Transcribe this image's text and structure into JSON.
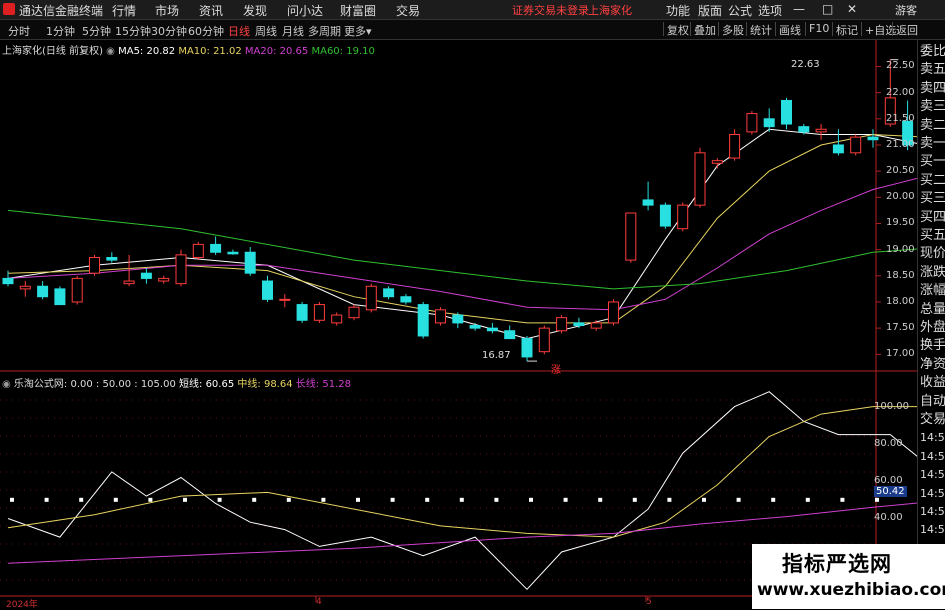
{
  "app": {
    "title": "通达信金融终端",
    "login_notice": "证券交易未登录",
    "stock_name": "上海家化",
    "guest": "游客"
  },
  "menu": {
    "items": [
      "行情",
      "市场",
      "资讯",
      "发现",
      "问小达",
      "财富圈",
      "交易"
    ],
    "right_items": [
      "功能",
      "版面",
      "公式",
      "选项"
    ]
  },
  "period_tabs": [
    "分时",
    "1分钟",
    "5分钟",
    "15分钟",
    "30分钟",
    "60分钟",
    "日线",
    "周线",
    "月线",
    "多周期",
    "更多"
  ],
  "active_tab": "日线",
  "toolbar": [
    "复权",
    "叠加",
    "多股",
    "统计",
    "画线",
    "F10",
    "标记",
    "+自选",
    "返回"
  ],
  "main_legend": {
    "title": "上海家化(日线 前复权)",
    "ma": [
      {
        "label": "MA5:",
        "value": "20.82",
        "color": "#ffffff"
      },
      {
        "label": "MA10:",
        "value": "21.02",
        "color": "#e8d460"
      },
      {
        "label": "MA20:",
        "value": "20.65",
        "color": "#d040d0"
      },
      {
        "label": "MA60:",
        "value": "19.10",
        "color": "#30c030"
      }
    ]
  },
  "indicator_legend": {
    "name": "乐淘公式网",
    "params": ": 0.00 : 50.00 : 105.00",
    "lines": [
      {
        "label": "短线:",
        "value": "60.65",
        "color": "#ffffff"
      },
      {
        "label": "中线:",
        "value": "98.64",
        "color": "#e8d460"
      },
      {
        "label": "长线:",
        "value": "51.28",
        "color": "#d040d0"
      }
    ]
  },
  "price_axis": [
    "22.50",
    "22.00",
    "21.50",
    "21.00",
    "20.50",
    "20.00",
    "19.50",
    "19.00",
    "18.50",
    "18.00",
    "17.50",
    "17.00"
  ],
  "indicator_axis": [
    "100.00",
    "80.00",
    "60.00",
    "40.00"
  ],
  "indicator_marker": "50.42",
  "annotations": {
    "high": "22.63",
    "low": "16.87",
    "signal": "涨"
  },
  "date_labels": [
    "2024年",
    "4",
    "5"
  ],
  "sidebar": [
    "委比",
    "卖五",
    "卖四",
    "卖三",
    "卖二",
    "卖一",
    "买一",
    "买二",
    "买三",
    "买四",
    "买五",
    "现价",
    "涨跌",
    "涨幅",
    "总量",
    "外盘",
    "换手",
    "净资",
    "收益",
    "自动",
    "交易",
    "14:56",
    "14:56",
    "14:56",
    "14:56",
    "14:56",
    "14:56",
    "14:56",
    "14:56",
    "14:56"
  ],
  "watermark": {
    "line1": "指标严选网",
    "line2": "www.xuezhibiao.com"
  },
  "chart_data": {
    "type": "candlestick",
    "price_range": [
      16.7,
      22.7
    ],
    "candles": [
      {
        "o": 18.45,
        "h": 18.6,
        "l": 18.3,
        "c": 18.35
      },
      {
        "o": 18.25,
        "h": 18.4,
        "l": 18.1,
        "c": 18.3
      },
      {
        "o": 18.3,
        "h": 18.4,
        "l": 18.05,
        "c": 18.1
      },
      {
        "o": 18.25,
        "h": 18.3,
        "l": 17.95,
        "c": 17.95
      },
      {
        "o": 18.0,
        "h": 18.5,
        "l": 17.95,
        "c": 18.45
      },
      {
        "o": 18.55,
        "h": 18.9,
        "l": 18.5,
        "c": 18.85
      },
      {
        "o": 18.85,
        "h": 18.95,
        "l": 18.75,
        "c": 18.8
      },
      {
        "o": 18.35,
        "h": 18.9,
        "l": 18.3,
        "c": 18.4
      },
      {
        "o": 18.55,
        "h": 18.65,
        "l": 18.35,
        "c": 18.45
      },
      {
        "o": 18.4,
        "h": 18.5,
        "l": 18.35,
        "c": 18.45
      },
      {
        "o": 18.35,
        "h": 19.0,
        "l": 18.3,
        "c": 18.9
      },
      {
        "o": 18.85,
        "h": 19.15,
        "l": 18.8,
        "c": 19.1
      },
      {
        "o": 19.1,
        "h": 19.25,
        "l": 18.9,
        "c": 18.95
      },
      {
        "o": 18.95,
        "h": 19.0,
        "l": 18.9,
        "c": 18.92
      },
      {
        "o": 18.95,
        "h": 19.05,
        "l": 18.5,
        "c": 18.55
      },
      {
        "o": 18.4,
        "h": 18.5,
        "l": 18.0,
        "c": 18.05
      },
      {
        "o": 18.05,
        "h": 18.15,
        "l": 17.9,
        "c": 18.05
      },
      {
        "o": 17.95,
        "h": 18.0,
        "l": 17.6,
        "c": 17.65
      },
      {
        "o": 17.65,
        "h": 18.0,
        "l": 17.6,
        "c": 17.95
      },
      {
        "o": 17.6,
        "h": 17.8,
        "l": 17.55,
        "c": 17.75
      },
      {
        "o": 17.7,
        "h": 17.95,
        "l": 17.65,
        "c": 17.9
      },
      {
        "o": 17.85,
        "h": 18.35,
        "l": 17.8,
        "c": 18.3
      },
      {
        "o": 18.25,
        "h": 18.3,
        "l": 18.05,
        "c": 18.1
      },
      {
        "o": 18.1,
        "h": 18.15,
        "l": 17.95,
        "c": 18.0
      },
      {
        "o": 17.95,
        "h": 18.0,
        "l": 17.3,
        "c": 17.35
      },
      {
        "o": 17.6,
        "h": 17.9,
        "l": 17.55,
        "c": 17.85
      },
      {
        "o": 17.75,
        "h": 17.8,
        "l": 17.5,
        "c": 17.6
      },
      {
        "o": 17.55,
        "h": 17.6,
        "l": 17.45,
        "c": 17.5
      },
      {
        "o": 17.5,
        "h": 17.6,
        "l": 17.4,
        "c": 17.45
      },
      {
        "o": 17.45,
        "h": 17.55,
        "l": 17.3,
        "c": 17.3
      },
      {
        "o": 17.3,
        "h": 17.35,
        "l": 16.87,
        "c": 16.95
      },
      {
        "o": 17.05,
        "h": 17.55,
        "l": 17.0,
        "c": 17.5
      },
      {
        "o": 17.45,
        "h": 17.75,
        "l": 17.4,
        "c": 17.7
      },
      {
        "o": 17.6,
        "h": 17.7,
        "l": 17.5,
        "c": 17.55
      },
      {
        "o": 17.5,
        "h": 17.65,
        "l": 17.45,
        "c": 17.6
      },
      {
        "o": 17.6,
        "h": 18.05,
        "l": 17.55,
        "c": 18.0
      },
      {
        "o": 18.8,
        "h": 19.7,
        "l": 18.75,
        "c": 19.7
      },
      {
        "o": 19.95,
        "h": 20.3,
        "l": 19.75,
        "c": 19.85
      },
      {
        "o": 19.85,
        "h": 19.9,
        "l": 19.4,
        "c": 19.45
      },
      {
        "o": 19.4,
        "h": 19.9,
        "l": 19.35,
        "c": 19.85
      },
      {
        "o": 19.85,
        "h": 20.95,
        "l": 19.8,
        "c": 20.85
      },
      {
        "o": 20.65,
        "h": 20.75,
        "l": 20.55,
        "c": 20.7
      },
      {
        "o": 20.75,
        "h": 21.3,
        "l": 20.7,
        "c": 21.2
      },
      {
        "o": 21.25,
        "h": 21.65,
        "l": 21.2,
        "c": 21.6
      },
      {
        "o": 21.5,
        "h": 21.7,
        "l": 21.25,
        "c": 21.35
      },
      {
        "o": 21.85,
        "h": 21.9,
        "l": 21.3,
        "c": 21.4
      },
      {
        "o": 21.35,
        "h": 21.4,
        "l": 21.2,
        "c": 21.25
      },
      {
        "o": 21.25,
        "h": 21.4,
        "l": 21.1,
        "c": 21.3
      },
      {
        "o": 21.0,
        "h": 21.3,
        "l": 20.8,
        "c": 20.85
      },
      {
        "o": 20.85,
        "h": 21.2,
        "l": 20.8,
        "c": 21.15
      },
      {
        "o": 21.15,
        "h": 21.3,
        "l": 20.95,
        "c": 21.1
      },
      {
        "o": 21.4,
        "h": 22.63,
        "l": 21.35,
        "c": 21.9
      },
      {
        "o": 21.45,
        "h": 21.85,
        "l": 20.9,
        "c": 21.0
      },
      {
        "o": 21.05,
        "h": 21.05,
        "l": 20.55,
        "c": 20.7
      },
      {
        "o": 20.95,
        "h": 21.1,
        "l": 20.8,
        "c": 20.85
      },
      {
        "o": 20.85,
        "h": 20.95,
        "l": 20.8,
        "c": 20.9
      },
      {
        "o": 20.95,
        "h": 21.25,
        "l": 20.45,
        "c": 20.5
      }
    ],
    "ma_lines": [
      {
        "name": "MA5",
        "color": "#ffffff",
        "x": [
          0,
          5,
          10,
          15,
          20,
          25,
          30,
          35,
          38,
          41,
          44,
          47,
          50,
          53,
          56
        ],
        "y": [
          18.45,
          18.7,
          18.85,
          18.7,
          17.95,
          17.75,
          17.3,
          17.7,
          19.2,
          20.6,
          21.3,
          21.2,
          21.2,
          21.0,
          20.82
        ]
      },
      {
        "name": "MA10",
        "color": "#e8d460",
        "x": [
          0,
          5,
          10,
          15,
          20,
          25,
          30,
          35,
          38,
          41,
          44,
          47,
          50,
          53,
          56
        ],
        "y": [
          18.55,
          18.6,
          18.7,
          18.6,
          18.1,
          17.8,
          17.6,
          17.6,
          18.3,
          19.6,
          20.5,
          21.0,
          21.2,
          21.15,
          21.02
        ]
      },
      {
        "name": "MA20",
        "color": "#d040d0",
        "x": [
          0,
          5,
          10,
          15,
          20,
          25,
          30,
          35,
          38,
          41,
          44,
          47,
          50,
          53,
          56
        ],
        "y": [
          18.45,
          18.55,
          18.7,
          18.7,
          18.45,
          18.2,
          17.9,
          17.85,
          18.05,
          18.65,
          19.3,
          19.75,
          20.15,
          20.4,
          20.65
        ]
      },
      {
        "name": "MA60",
        "color": "#30c030",
        "x": [
          0,
          10,
          20,
          30,
          35,
          40,
          45,
          50,
          56
        ],
        "y": [
          19.75,
          19.4,
          18.8,
          18.4,
          18.25,
          18.35,
          18.6,
          18.95,
          19.1
        ]
      }
    ],
    "indicator": {
      "range": [
        0,
        110
      ],
      "series": [
        {
          "name": "短线",
          "color": "#ffffff",
          "x": [
            0,
            3,
            6,
            8,
            10,
            12,
            14,
            16,
            18,
            21,
            24,
            27,
            30,
            32,
            35,
            37,
            39,
            42,
            44,
            46,
            48,
            51,
            53,
            55,
            56
          ],
          "y": [
            40,
            30,
            65,
            52,
            62,
            48,
            38,
            34,
            25,
            30,
            20,
            30,
            2,
            22,
            30,
            45,
            75,
            100,
            108,
            92,
            85,
            85,
            70,
            65,
            60.65
          ]
        },
        {
          "name": "中线",
          "color": "#e8d460",
          "x": [
            0,
            5,
            10,
            15,
            20,
            25,
            30,
            35,
            38,
            41,
            44,
            47,
            50,
            53,
            56
          ],
          "y": [
            35,
            42,
            52,
            54,
            45,
            36,
            32,
            30,
            38,
            58,
            84,
            96,
            100,
            100,
            98.64
          ]
        },
        {
          "name": "长线",
          "color": "#d040d0",
          "x": [
            0,
            10,
            20,
            30,
            35,
            40,
            45,
            50,
            56
          ],
          "y": [
            16,
            20,
            24,
            30,
            32,
            37,
            41,
            46,
            51.28
          ]
        }
      ],
      "dotted_level": 50
    }
  }
}
